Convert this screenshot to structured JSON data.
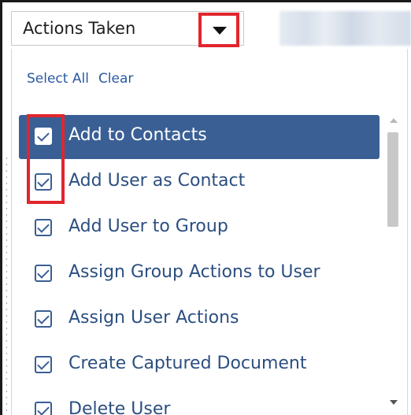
{
  "filter": {
    "label": "Actions Taken",
    "dropdown_icon": "triangle-down-icon"
  },
  "links": {
    "select_all": "Select All",
    "clear": "Clear"
  },
  "options": [
    {
      "label": "Add to Contacts",
      "checked": true,
      "highlighted": true
    },
    {
      "label": "Add User as Contact",
      "checked": true,
      "highlighted": false
    },
    {
      "label": "Add User to Group",
      "checked": true,
      "highlighted": false
    },
    {
      "label": "Assign Group Actions to User",
      "checked": true,
      "highlighted": false
    },
    {
      "label": "Assign User Actions",
      "checked": true,
      "highlighted": false
    },
    {
      "label": "Create Captured Document",
      "checked": true,
      "highlighted": false
    },
    {
      "label": "Delete User",
      "checked": true,
      "highlighted": false
    }
  ],
  "colors": {
    "accent": "#3a5f95",
    "link": "#2a5aa0",
    "annotation_red": "#e0262d",
    "option_text": "#2c4f80"
  }
}
